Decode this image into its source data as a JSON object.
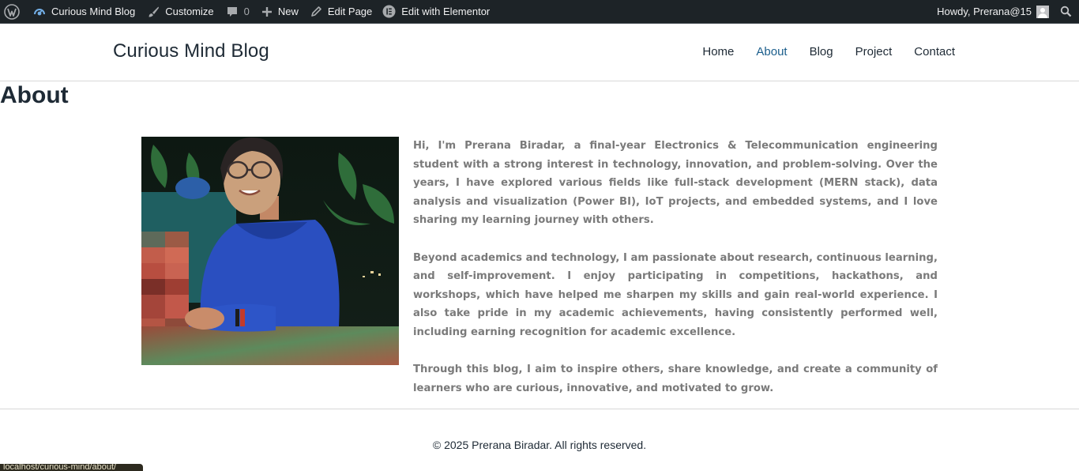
{
  "admin_bar": {
    "wp_logo_icon": "wordpress-logo-icon",
    "site_name": "Curious Mind Blog",
    "customize": "Customize",
    "comments_count": "0",
    "new": "New",
    "edit_page": "Edit Page",
    "edit_elementor": "Edit with Elementor",
    "howdy": "Howdy, Prerana@15",
    "search_icon": "search-icon"
  },
  "header": {
    "site_title": "Curious Mind Blog",
    "nav": [
      {
        "label": "Home",
        "active": false
      },
      {
        "label": "About",
        "active": true
      },
      {
        "label": "Blog",
        "active": false
      },
      {
        "label": "Project",
        "active": false
      },
      {
        "label": "Contact",
        "active": false
      }
    ]
  },
  "page": {
    "title": "About",
    "paragraphs": [
      "Hi, I'm Prerana Biradar, a final-year Electronics & Telecommunication engineering student with a strong interest in technology, innovation, and problem-solving. Over the years, I have explored various fields like full-stack development (MERN stack), data analysis and visualization (Power BI), IoT projects, and embedded systems, and I love sharing my learning journey with others.",
      "Beyond academics and technology, I am passionate about research, continuous learning, and self-improvement. I enjoy participating in competitions, hackathons, and workshops, which have helped me sharpen my skills and gain real-world experience. I also take pride in my academic achievements, having consistently performed well, including earning recognition for academic excellence.",
      "Through this blog, I aim to inspire others, share knowledge, and create a community of learners who are curious, innovative, and motivated to grow."
    ]
  },
  "footer": {
    "copyright": "© 2025 Prerana Biradar. All rights reserved."
  },
  "status_bar": {
    "url": "localhost/curious-mind/about/"
  },
  "colors": {
    "admin_bar_bg": "#1d2327",
    "nav_active": "#1b5e8c",
    "body_text": "#7a7a7a",
    "heading": "#1e2a35"
  }
}
